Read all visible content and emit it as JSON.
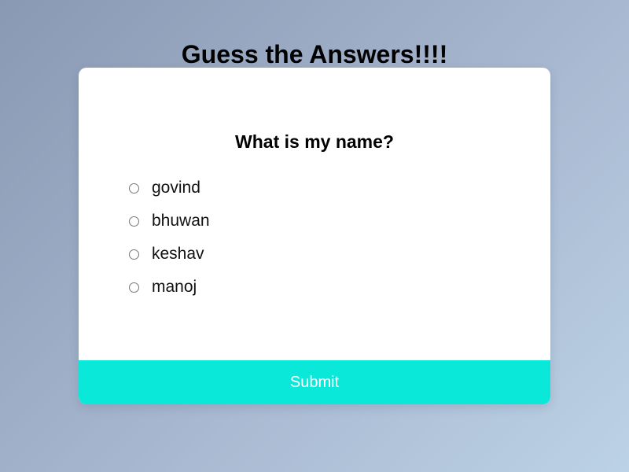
{
  "page": {
    "title": "Guess the Answers!!!!"
  },
  "quiz": {
    "question": "What is my name?",
    "answers": [
      {
        "label": "govind",
        "selected": false
      },
      {
        "label": "bhuwan",
        "selected": false
      },
      {
        "label": "keshav",
        "selected": false
      },
      {
        "label": "manoj",
        "selected": false
      }
    ],
    "submit_label": "Submit"
  },
  "colors": {
    "submit_background": "#0ae8da",
    "card_background": "#ffffff"
  }
}
